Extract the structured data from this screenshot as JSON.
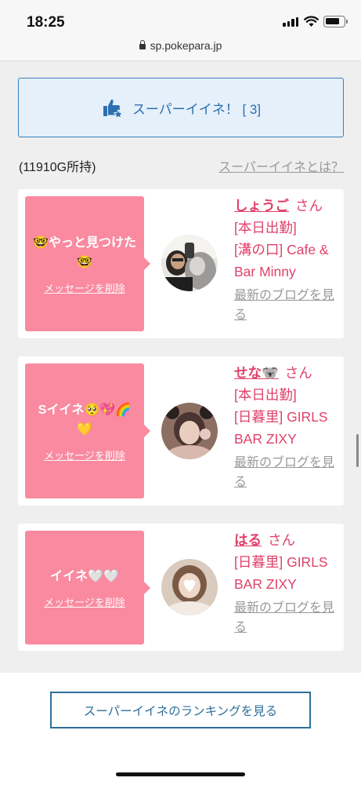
{
  "status_bar": {
    "time": "18:25",
    "url": "sp.pokepara.jp"
  },
  "super_iine": {
    "button_label": "スーパーイイネ！ [ 3]",
    "owned": "(11910G所持)",
    "what_link": "スーパーイイネとは？"
  },
  "cards": [
    {
      "message": "🤓やっと見つけた🤓",
      "delete_label": "メッセージを削除",
      "name": "しょうご",
      "honorific": "さん",
      "status": "[本日出勤]",
      "shop": "[溝の口] Cafe & Bar Minny",
      "blog_label": "最新のブログを見る"
    },
    {
      "message": "Sイイネ🥺💖🌈💛",
      "delete_label": "メッセージを削除",
      "name": "せな🐨",
      "honorific": "さん",
      "status": "[本日出勤]",
      "shop": "[日暮里] GIRLS BAR ZIXY",
      "blog_label": "最新のブログを見る"
    },
    {
      "message": "イイネ🤍🤍",
      "delete_label": "メッセージを削除",
      "name": "はる",
      "honorific": "さん",
      "shop": "[日暮里] GIRLS BAR ZIXY",
      "blog_label": "最新のブログを見る"
    }
  ],
  "ranking_button": "スーパーイイネのランキングを見る",
  "colors": {
    "accent_pink": "#e0416b",
    "bubble_pink": "#f98aa0",
    "button_blue": "#2d6fb0"
  }
}
